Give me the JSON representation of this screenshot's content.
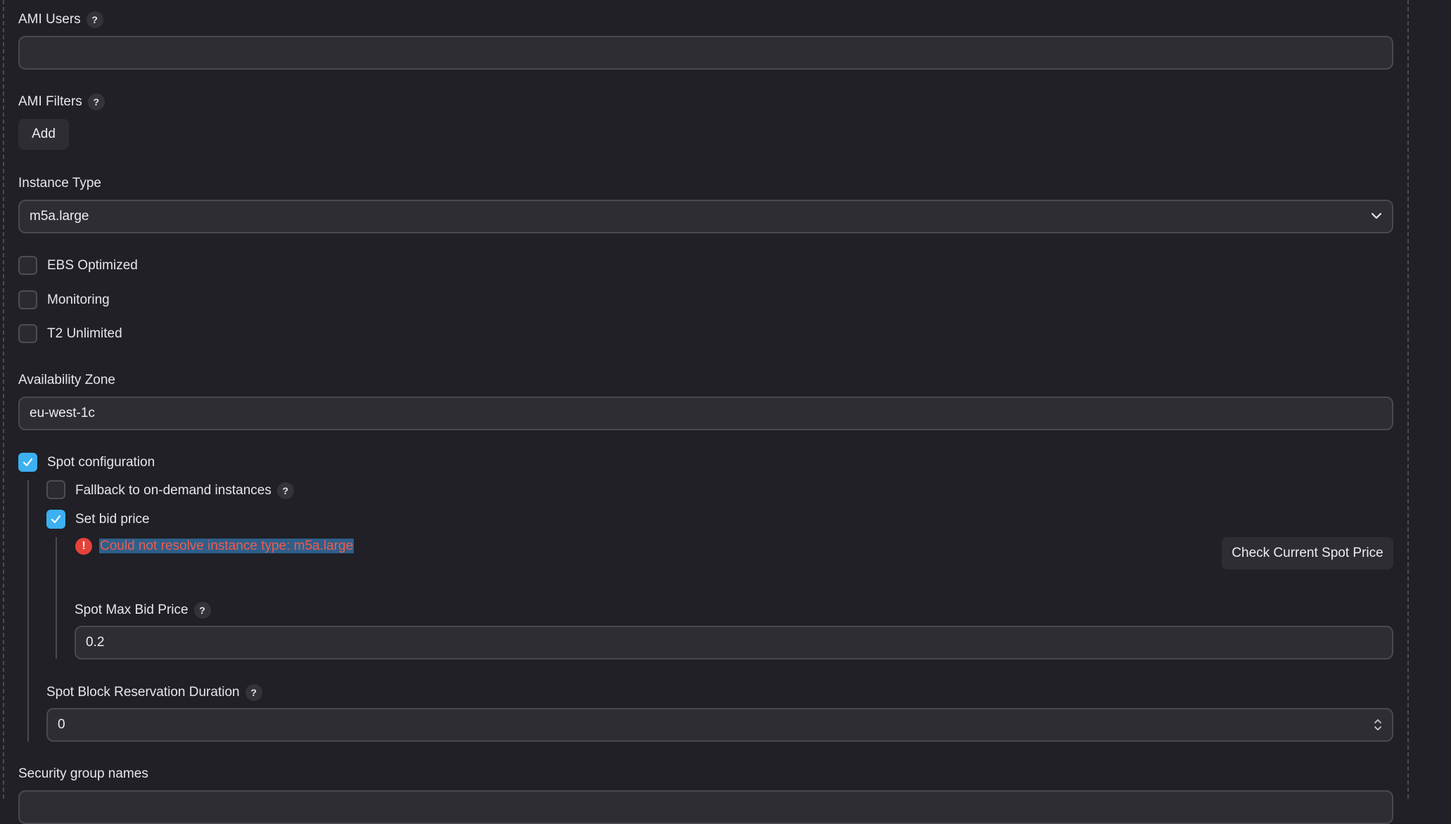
{
  "ami_users": {
    "label": "AMI Users",
    "help": "?",
    "value": ""
  },
  "ami_filters": {
    "label": "AMI Filters",
    "help": "?",
    "add_label": "Add"
  },
  "instance_type": {
    "label": "Instance Type",
    "value": "m5a.large"
  },
  "checkboxes": {
    "ebs_optimized": {
      "label": "EBS Optimized",
      "checked": false
    },
    "monitoring": {
      "label": "Monitoring",
      "checked": false
    },
    "t2_unlimited": {
      "label": "T2 Unlimited",
      "checked": false
    }
  },
  "availability_zone": {
    "label": "Availability Zone",
    "value": "eu-west-1c"
  },
  "spot": {
    "label": "Spot configuration",
    "checked": true,
    "fallback": {
      "label": "Fallback to on-demand instances",
      "help": "?",
      "checked": false
    },
    "set_bid_price": {
      "label": "Set bid price",
      "checked": true
    },
    "error_text": "Could not resolve instance type: m5a.large",
    "check_price_label": "Check Current Spot Price",
    "max_bid": {
      "label": "Spot Max Bid Price",
      "help": "?",
      "value": "0.2"
    },
    "block_duration": {
      "label": "Spot Block Reservation Duration",
      "help": "?",
      "value": "0"
    }
  },
  "security_groups": {
    "label": "Security group names"
  },
  "colors": {
    "accent": "#3cb0f0",
    "error": "#f05a4e",
    "background": "#202026"
  }
}
